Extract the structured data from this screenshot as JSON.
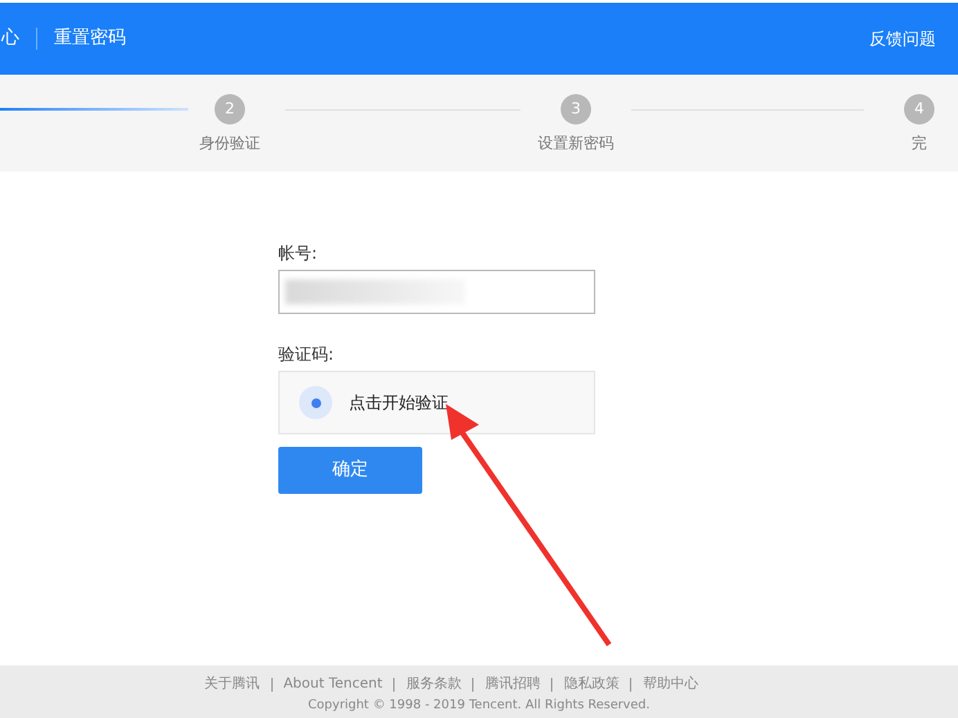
{
  "header": {
    "site_name": "心",
    "title": "重置密码",
    "feedback_link": "反馈问题"
  },
  "steps": [
    {
      "number": "2",
      "label": "身份验证",
      "reached": false
    },
    {
      "number": "3",
      "label": "设置新密码",
      "reached": false
    },
    {
      "number": "4",
      "label": "完",
      "reached": false
    }
  ],
  "form": {
    "account_label": "帐号:",
    "captcha_label": "验证码:",
    "captcha_prompt": "点击开始验证",
    "submit": "确定"
  },
  "footer": {
    "links": [
      "关于腾讯",
      "About Tencent",
      "服务条款",
      "腾讯招聘",
      "隐私政策",
      "帮助中心"
    ],
    "copyright": "Copyright © 1998 - 2019 Tencent. All Rights Reserved."
  }
}
